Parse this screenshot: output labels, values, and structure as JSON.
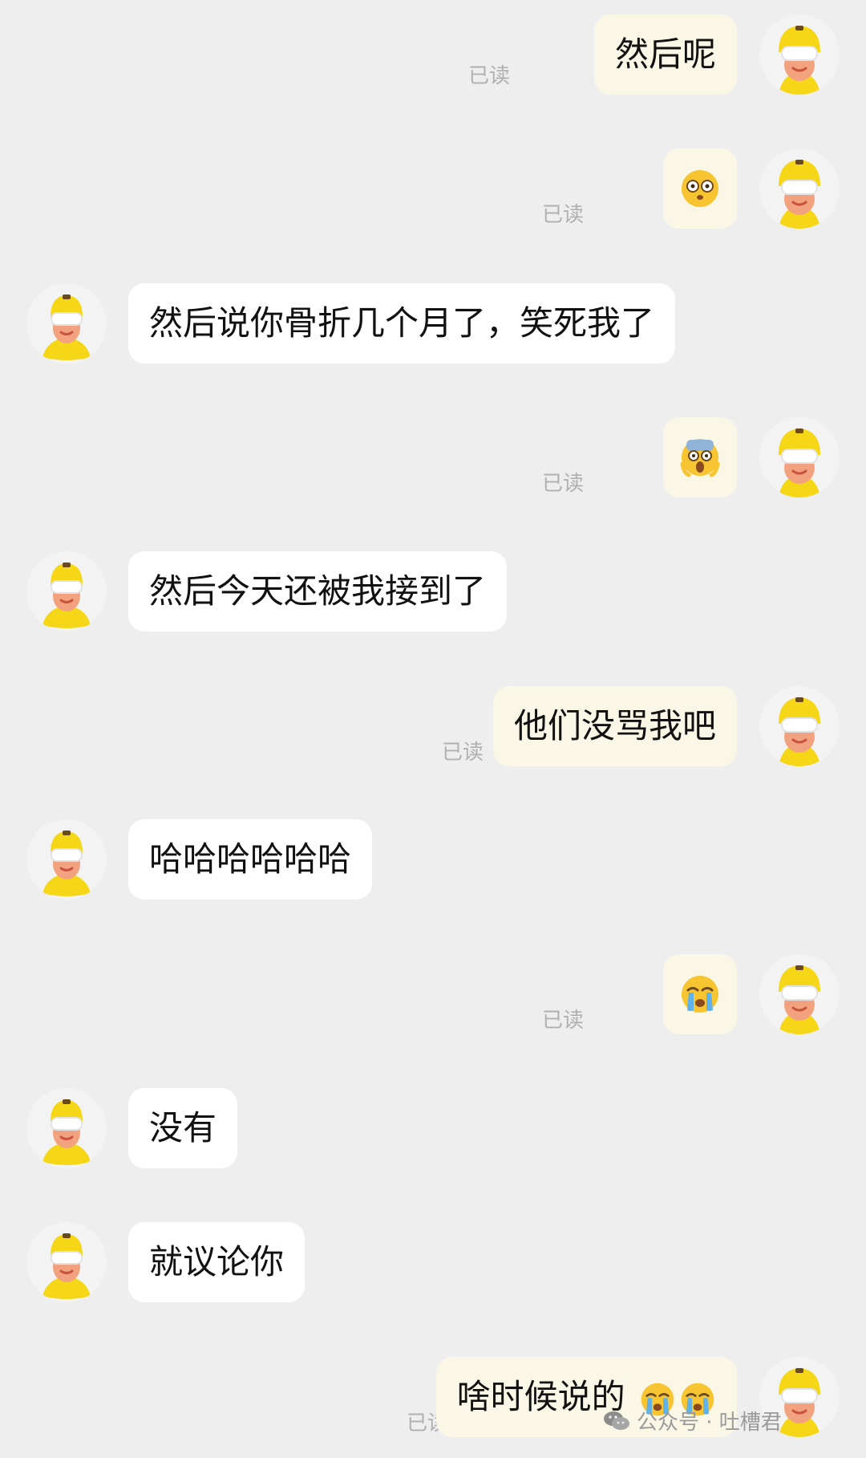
{
  "status": {
    "read": "已读"
  },
  "messages": [
    {
      "side": "right",
      "type": "text",
      "text": "然后呢",
      "read": "已读"
    },
    {
      "side": "right",
      "type": "emoji",
      "emoji": "surprised-face-icon",
      "read": "已读"
    },
    {
      "side": "left",
      "type": "text",
      "text": "然后说你骨折几个月了，笑死我了"
    },
    {
      "side": "right",
      "type": "emoji",
      "emoji": "screaming-face-icon",
      "read": "已读"
    },
    {
      "side": "left",
      "type": "text",
      "text": "然后今天还被我接到了"
    },
    {
      "side": "right",
      "type": "text",
      "text": "他们没骂我吧",
      "read": "已读"
    },
    {
      "side": "left",
      "type": "text",
      "text": "哈哈哈哈哈哈"
    },
    {
      "side": "right",
      "type": "emoji",
      "emoji": "crying-face-icon",
      "read": "已读"
    },
    {
      "side": "left",
      "type": "text",
      "text": "没有"
    },
    {
      "side": "left",
      "type": "text",
      "text": "就议论你"
    },
    {
      "side": "right",
      "type": "text-emoji",
      "text": "啥时候说的",
      "emojis": [
        "crying-face-icon",
        "crying-face-icon"
      ],
      "read": "已读"
    }
  ],
  "watermark": {
    "label": "公众号 · 吐槽君",
    "icon": "wechat-icon"
  },
  "colors": {
    "background": "#eeeeee",
    "bubble_received": "#ffffff",
    "bubble_sent": "#fbf7e6",
    "helmet": "#f5d718",
    "read_text": "#b0b0b0"
  }
}
